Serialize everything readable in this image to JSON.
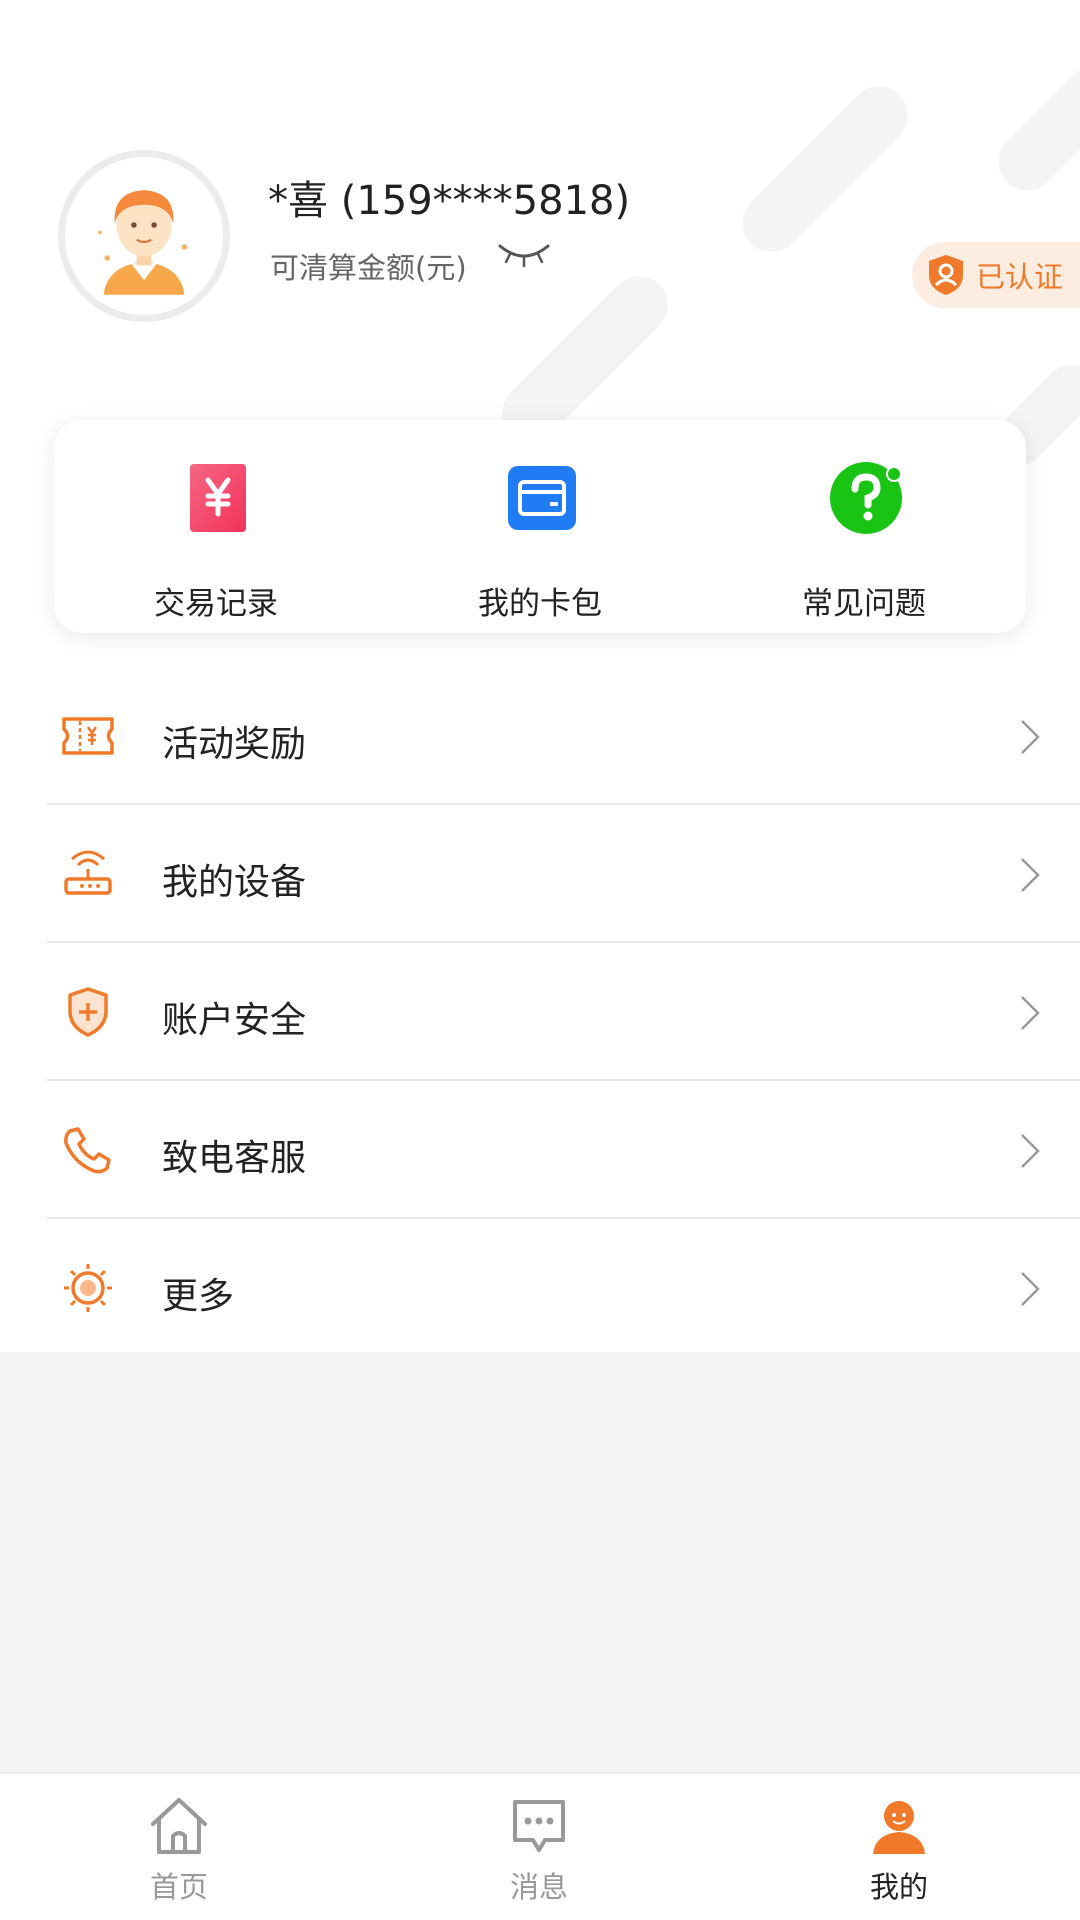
{
  "profile": {
    "username": "*喜 (159****5818)",
    "balance_label": "可清算金额(元)",
    "verified_label": "已认证"
  },
  "quick_actions": [
    {
      "label": "交易记录",
      "icon": "yuan-receipt-icon"
    },
    {
      "label": "我的卡包",
      "icon": "card-wallet-icon"
    },
    {
      "label": "常见问题",
      "icon": "question-bubble-icon"
    }
  ],
  "menu": [
    {
      "label": "活动奖励",
      "icon": "coupon-icon"
    },
    {
      "label": "我的设备",
      "icon": "router-device-icon"
    },
    {
      "label": "账户安全",
      "icon": "shield-icon"
    },
    {
      "label": "致电客服",
      "icon": "phone-icon"
    },
    {
      "label": "更多",
      "icon": "sun-gear-icon"
    }
  ],
  "tabbar": [
    {
      "label": "首页",
      "icon": "home-icon",
      "active": false
    },
    {
      "label": "消息",
      "icon": "message-icon",
      "active": false
    },
    {
      "label": "我的",
      "icon": "person-icon",
      "active": true
    }
  ],
  "colors": {
    "accent": "#f07a2a",
    "receipt_red": "#f2335a",
    "card_blue": "#1f7cf5",
    "help_green": "#19c414"
  }
}
